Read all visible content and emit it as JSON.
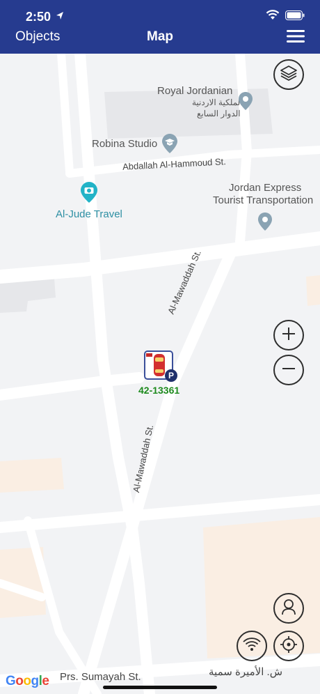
{
  "status_bar": {
    "time": "2:50"
  },
  "nav": {
    "left_label": "Objects",
    "title": "Map"
  },
  "map": {
    "pois": {
      "royal_jordanian_en": "Royal Jordanian",
      "royal_jordanian_ar_1": "الملكية الاردنية",
      "royal_jordanian_ar_2": "الدوار السابع",
      "robina": "Robina Studio",
      "al_jude": "Al-Jude Travel",
      "jordan_express_1": "Jordan Express",
      "jordan_express_2": "Tourist Transportation"
    },
    "roads": {
      "abdallah": "Abdallah Al-Hammoud St.",
      "mawaddah_upper": "Al-Mawaddah St.",
      "mawaddah_lower": "Al-Mawaddah St.",
      "sumayah_en": "Prs. Sumayah St.",
      "sumayah_ar": "ش. الأميرة سمية"
    },
    "vehicle": {
      "plate": "42-13361",
      "status_badge": "P"
    },
    "attribution": "Google"
  },
  "icons": {
    "layers": "layers-icon",
    "zoom_in": "plus-icon",
    "zoom_out": "minus-icon",
    "profile": "person-icon",
    "signal": "wifi-icon",
    "locate": "crosshair-icon"
  }
}
